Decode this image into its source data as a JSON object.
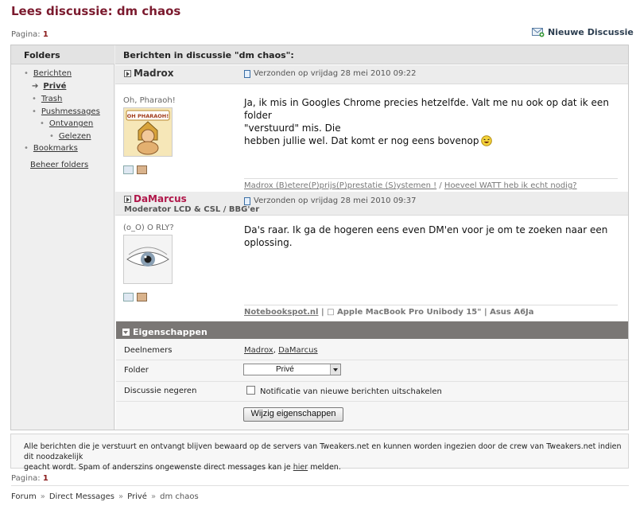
{
  "page_title": "Lees discussie: dm chaos",
  "pagination": {
    "label": "Pagina:",
    "page": "1"
  },
  "new_discussion": "Nieuwe Discussie",
  "sidebar": {
    "title": "Folders",
    "items": [
      {
        "label": "Berichten"
      },
      {
        "label": "Privé"
      },
      {
        "label": "Trash"
      },
      {
        "label": "Pushmessages"
      },
      {
        "label": "Ontvangen"
      },
      {
        "label": "Gelezen"
      },
      {
        "label": "Bookmarks"
      },
      {
        "label": "Beheer folders"
      }
    ]
  },
  "main_title": "Berichten in discussie \"dm chaos\":",
  "posts": [
    {
      "author": "Madrox",
      "sent": "Verzonden op vrijdag 28 mei 2010 09:22",
      "status": "Oh, Pharaoh!",
      "avatar_text": "OH PHARAOH!",
      "body_lines": [
        "Ja, ik mis in Googles Chrome precies hetzelfde. Valt me nu ook op dat ik een folder",
        "\"verstuurd\" mis. Die",
        "hebben jullie wel. Dat komt er nog eens bovenop"
      ],
      "sig_link1": "Madrox (B)etere(P)prijs(P)prestatie (S)ystemen !",
      "sig_sep": " / ",
      "sig_link2": "Hoeveel WATT heb ik echt nodig?"
    },
    {
      "author": "DaMarcus",
      "author_color": "#b0174a",
      "role": "Moderator LCD & CSL / BBG'er",
      "sent": "Verzonden op vrijdag 28 mei 2010 09:37",
      "status": "(o_O) O RLY?",
      "body_lines": [
        "Da's raar. Ik ga de hogeren eens even DM'en voor je om te zoeken naar een oplossing."
      ],
      "sig_link": "Notebookspot.nl",
      "sig_text": " | □ Apple MacBook Pro Unibody 15\" | Asus A6Ja"
    }
  ],
  "properties": {
    "title": "Eigenschappen",
    "participants_label": "Deelnemers",
    "participant1": "Madrox",
    "participant_sep": ", ",
    "participant2": "DaMarcus",
    "folder_label": "Folder",
    "folder_value": "Privé",
    "ignore_label": "Discussie negeren",
    "ignore_checkbox_label": "Notificatie van nieuwe berichten uitschakelen",
    "save_button": "Wijzig eigenschappen"
  },
  "notice": {
    "line1": "Alle berichten die je verstuurt en ontvangt blijven bewaard op de servers van Tweakers.net en kunnen worden ingezien door de crew van Tweakers.net indien dit noodzakelijk",
    "line2_pre": "geacht wordt. Spam of anderszins ongewenste direct messages kan je ",
    "line2_link": "hier",
    "line2_post": " melden."
  },
  "breadcrumb": [
    "Forum",
    "Direct Messages",
    "Privé",
    "dm chaos"
  ],
  "breadcrumb_sep": "»"
}
